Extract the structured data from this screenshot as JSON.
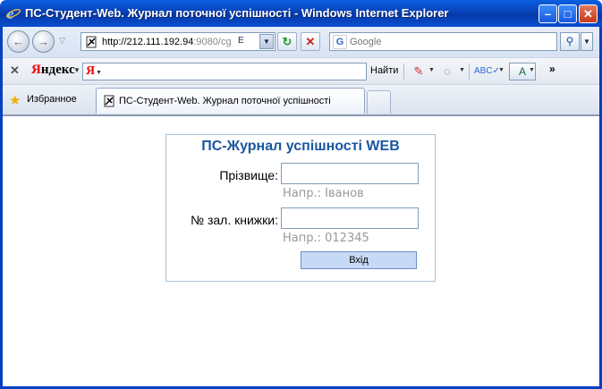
{
  "window": {
    "title": "ПС-Студент-Web. Журнал поточної успішності - Windows Internet Explorer",
    "minimize_glyph": "–",
    "maximize_glyph": "□",
    "close_glyph": "✕"
  },
  "address_bar": {
    "url_host": "http://212.111.192.94",
    "url_rest": ":9080/cg",
    "compat_glyph": "E",
    "back_glyph": "←",
    "forward_glyph": "→",
    "refresh_glyph": "↻",
    "stop_glyph": "✕"
  },
  "search": {
    "placeholder": "Google",
    "engine_glyph": "G",
    "go_glyph": "⚲"
  },
  "yandex_toolbar": {
    "logo_first": "Я",
    "logo_rest": "ндекс",
    "input_glyph": "Я",
    "find_label": "Найти",
    "more_glyph": "»",
    "close_glyph": "✕",
    "pencil_glyph": "✎",
    "bubble_glyph": "◌",
    "spell_glyph": "ABC✓",
    "translate_glyph": "A"
  },
  "favorites": {
    "label": "Избранное",
    "star_glyph": "★"
  },
  "tab": {
    "title": "ПС-Студент-Web. Журнал поточної успішності"
  },
  "login": {
    "title": "ПС-Журнал успішності WEB",
    "surname_label": "Прізвище:",
    "surname_value": "",
    "surname_hint": "Напр.: Іванов",
    "record_book_label": "№ зал. книжки:",
    "record_book_value": "",
    "record_book_hint": "Напр.: 012345",
    "submit_label": "Вхід"
  },
  "colors": {
    "titlebar": "#0842b8",
    "panel_border": "#a9c4dc",
    "login_title": "#1a57a0",
    "submit_bg": "#c6d9f7"
  }
}
